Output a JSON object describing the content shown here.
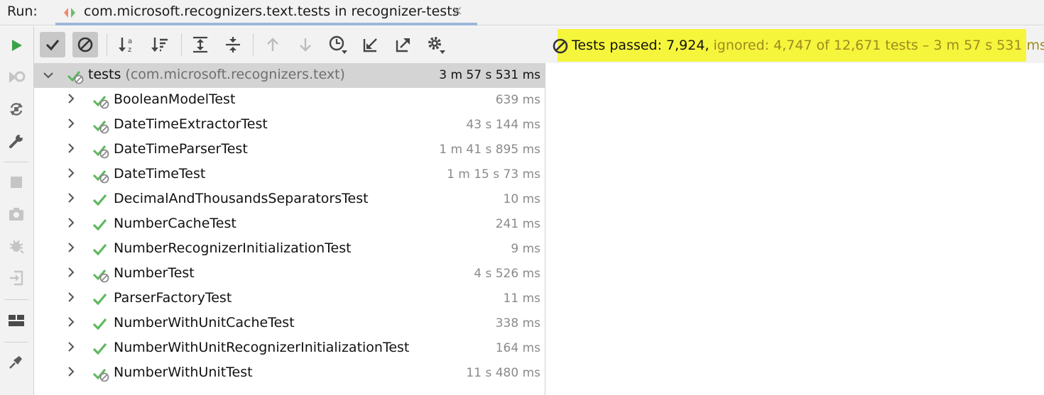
{
  "run_bar": {
    "label": "Run:",
    "tab_title": "com.microsoft.recognizers.text.tests in recognizer-tests",
    "tab_close": "×"
  },
  "status": {
    "passed_text": "Tests passed: 7,924,",
    "ignored_text": " ignored: 4,747 of 12,671 tests – 3 m 57 s 531 ms",
    "highlight_color": "#f5f53c"
  },
  "tree": {
    "root": {
      "name": "tests",
      "package": " (com.microsoft.recognizers.text)",
      "time": "3 m 57 s 531 ms",
      "status": "passed-with-ignored"
    },
    "items": [
      {
        "name": "BooleanModelTest",
        "time": "639 ms",
        "status": "passed-with-ignored"
      },
      {
        "name": "DateTimeExtractorTest",
        "time": "43 s 144 ms",
        "status": "passed-with-ignored"
      },
      {
        "name": "DateTimeParserTest",
        "time": "1 m 41 s 895 ms",
        "status": "passed-with-ignored"
      },
      {
        "name": "DateTimeTest",
        "time": "1 m 15 s 73 ms",
        "status": "passed-with-ignored"
      },
      {
        "name": "DecimalAndThousandsSeparatorsTest",
        "time": "10 ms",
        "status": "passed"
      },
      {
        "name": "NumberCacheTest",
        "time": "241 ms",
        "status": "passed"
      },
      {
        "name": "NumberRecognizerInitializationTest",
        "time": "9 ms",
        "status": "passed"
      },
      {
        "name": "NumberTest",
        "time": "4 s 526 ms",
        "status": "passed-with-ignored"
      },
      {
        "name": "ParserFactoryTest",
        "time": "11 ms",
        "status": "passed"
      },
      {
        "name": "NumberWithUnitCacheTest",
        "time": "338 ms",
        "status": "passed"
      },
      {
        "name": "NumberWithUnitRecognizerInitializationTest",
        "time": "164 ms",
        "status": "passed"
      },
      {
        "name": "NumberWithUnitTest",
        "time": "11 s 480 ms",
        "status": "passed-with-ignored"
      }
    ]
  },
  "toolbar": {
    "buttons": [
      "show-passed-icon",
      "show-ignored-icon",
      "sort-alphabetically-icon",
      "sort-by-duration-icon",
      "expand-all-icon",
      "collapse-all-icon",
      "previous-failed-icon",
      "next-failed-icon",
      "test-history-icon",
      "import-tests-icon",
      "export-tests-icon",
      "settings-icon"
    ]
  },
  "left_toolbar": {
    "buttons": [
      "run-icon",
      "rerun-failed-icon",
      "toggle-autotest-icon",
      "settings-wrench-icon",
      "stop-icon",
      "screenshot-icon",
      "debug-icon",
      "exit-icon",
      "layout-icon",
      "pin-icon"
    ]
  },
  "colors": {
    "pass_green": "#5fb85f",
    "ignored_gray": "#8a8a8a",
    "selected_row": "#d4d4d4"
  }
}
